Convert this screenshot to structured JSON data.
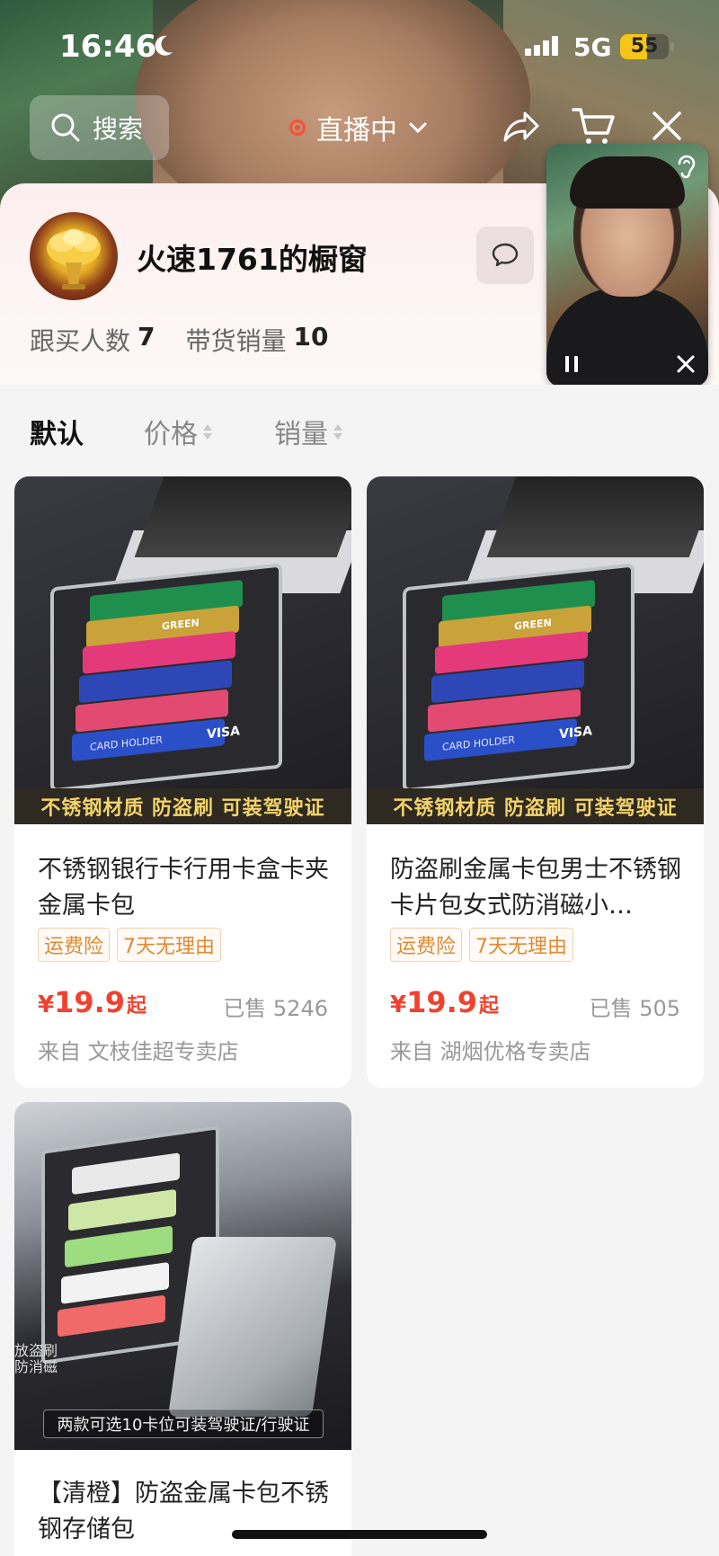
{
  "status": {
    "time": "16:46",
    "network": "5G",
    "battery": "55",
    "battery_level": 0.55
  },
  "topbar": {
    "search_label": "搜索",
    "live_label": "直播中"
  },
  "shop": {
    "name": "火速1761的橱窗",
    "followers_label": "跟买人数",
    "followers_value": "7",
    "sales_label": "带货销量",
    "sales_value": "10"
  },
  "sort": {
    "default": "默认",
    "price": "价格",
    "sales": "销量"
  },
  "products": [
    {
      "title": "不锈钢银行卡行用卡盒卡夹金属卡包",
      "tags": [
        "运费险",
        "7天无理由"
      ],
      "currency": "¥",
      "price": "19.9",
      "price_suffix": "起",
      "sold": "已售 5246",
      "shop": "来自 文枝佳超专卖店",
      "banner": "不锈钢材质 防盗刷 可装驾驶证",
      "card_brand": "VISA",
      "card_label": "CARD HOLDER",
      "card_green": "GREEN"
    },
    {
      "title": "防盗刷金属卡包男士不锈钢卡片包女式防消磁小…",
      "tags": [
        "运费险",
        "7天无理由"
      ],
      "currency": "¥",
      "price": "19.9",
      "price_suffix": "起",
      "sold": "已售 505",
      "shop": "来自 湖烟优格专卖店",
      "banner": "不锈钢材质 防盗刷 可装驾驶证",
      "card_brand": "VISA",
      "card_label": "CARD HOLDER",
      "card_green": "GREEN"
    },
    {
      "title": "【清橙】防盗金属卡包不锈钢存储包",
      "side_text": "放盗刷\n防消磁",
      "bottom_text": "两款可选10卡位可装驾驶证/行驶证"
    }
  ],
  "colors": {
    "price": "#f2412f",
    "tag": "#e08a34",
    "live_dot": "#ff4d3a",
    "banner_text": "#f3d36a"
  }
}
